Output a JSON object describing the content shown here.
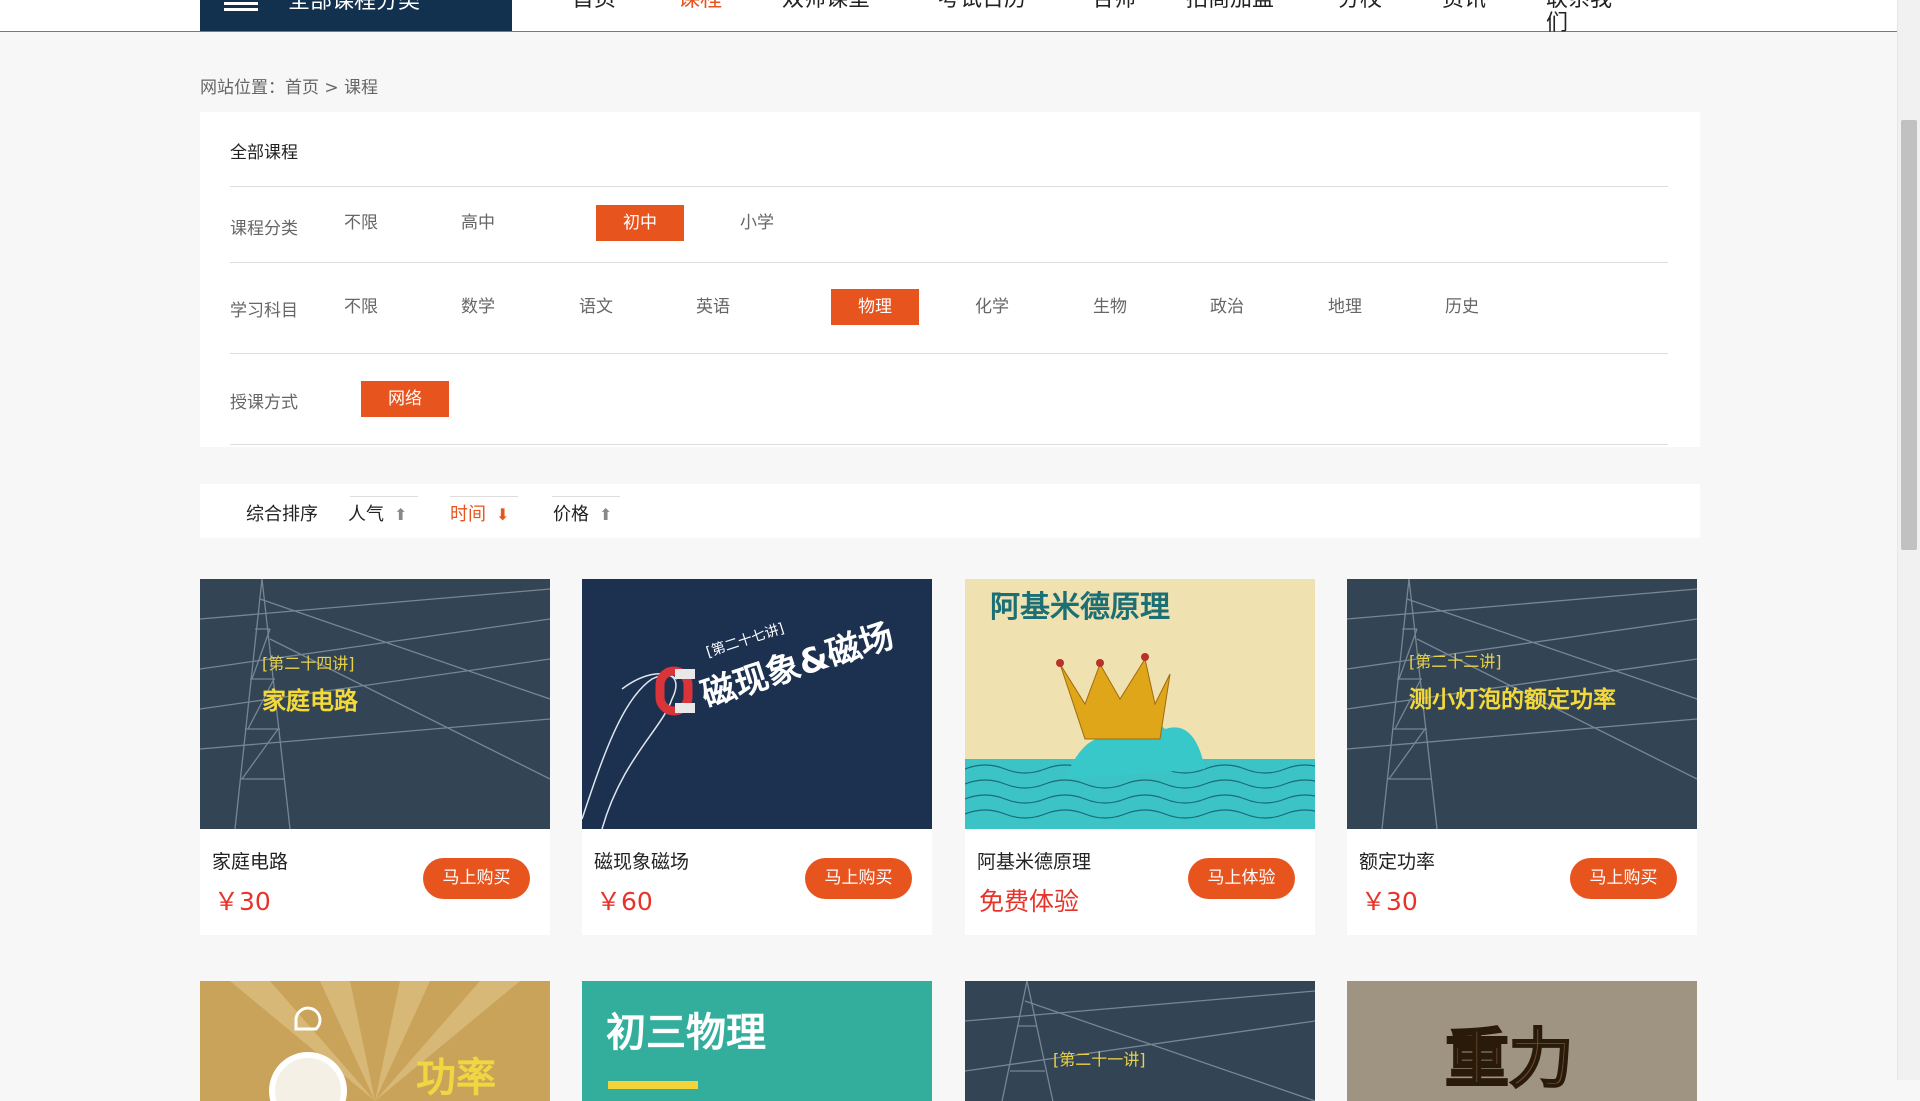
{
  "nav": {
    "category_label": "全部课程分类",
    "links": [
      "首页",
      "课程",
      "双师课堂",
      "考试日历",
      "合师",
      "招商加盟",
      "分校",
      "资讯",
      "联系我们"
    ],
    "active_index": 1,
    "accent": "#e8541e",
    "dark": "#12314f"
  },
  "breadcrumb": "网站位置：首页 > 课程",
  "filter": {
    "all_label": "全部课程",
    "rows": [
      {
        "label": "课程分类",
        "options": [
          "不限",
          "高中",
          "初中",
          "小学"
        ],
        "selected": 2
      },
      {
        "label": "学习科目",
        "options": [
          "不限",
          "数学",
          "语文",
          "英语",
          "物理",
          "化学",
          "生物",
          "政治",
          "地理",
          "历史"
        ],
        "selected": 4
      },
      {
        "label": "授课方式",
        "options": [
          "网络"
        ],
        "selected": 0
      }
    ]
  },
  "sort": {
    "items": [
      {
        "label": "综合排序",
        "arrow": ""
      },
      {
        "label": "人气",
        "arrow": "🠕"
      },
      {
        "label": "时间",
        "arrow": "🠗"
      },
      {
        "label": "价格",
        "arrow": "🠕"
      }
    ],
    "active_index": 2
  },
  "courses": [
    {
      "title": "家庭电路",
      "price": "￥30",
      "button": "马上购买",
      "cover_tag": "[第二十四讲]",
      "cover_title": "家庭电路"
    },
    {
      "title": "磁现象磁场",
      "price": "￥60",
      "button": "马上购买",
      "cover_tag": "[第二十七讲]",
      "cover_title": "磁现象&磁场"
    },
    {
      "title": "阿基米德原理",
      "price": "免费体验",
      "button": "马上体验",
      "cover_tag": "",
      "cover_title": "阿基米德原理"
    },
    {
      "title": "额定功率",
      "price": "￥30",
      "button": "马上购买",
      "cover_tag": "[第二十二讲]",
      "cover_title": "测小灯泡的额定功率"
    }
  ],
  "courses_row2": [
    {
      "cover_title": "功率"
    },
    {
      "cover_title": "初三物理"
    },
    {
      "cover_tag": "[第二十一讲]"
    },
    {
      "cover_title": "重力"
    }
  ]
}
